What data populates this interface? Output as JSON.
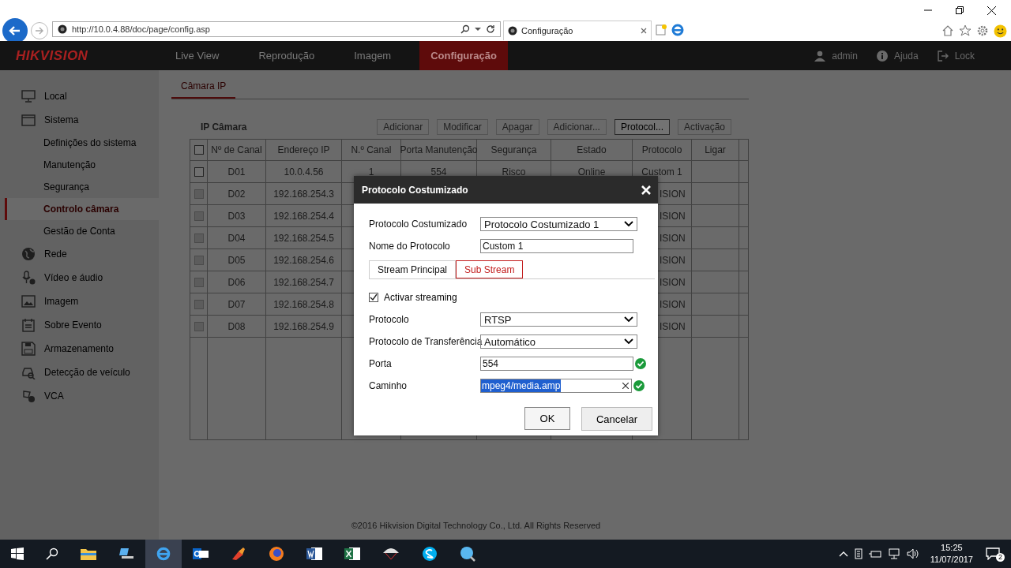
{
  "browser": {
    "address": "http://10.0.4.88/doc/page/config.asp",
    "tab_title": "Configuração"
  },
  "nav": {
    "logo": "HIKVISION",
    "items": [
      {
        "label": "Live View",
        "selected": false
      },
      {
        "label": "Reprodução",
        "selected": false
      },
      {
        "label": "Imagem",
        "selected": false
      },
      {
        "label": "Configuração",
        "selected": true
      }
    ],
    "user": "admin",
    "help": "Ajuda",
    "lock": "Lock"
  },
  "sidebar": [
    {
      "kind": "section",
      "label": "Local",
      "selected": false
    },
    {
      "kind": "section",
      "label": "Sistema",
      "selected": false
    },
    {
      "kind": "sub",
      "label": "Definições do sistema",
      "selected": false
    },
    {
      "kind": "sub",
      "label": "Manutenção",
      "selected": false
    },
    {
      "kind": "sub",
      "label": "Segurança",
      "selected": false
    },
    {
      "kind": "sub",
      "label": "Controlo câmara",
      "selected": true
    },
    {
      "kind": "sub",
      "label": "Gestão de Conta",
      "selected": false
    },
    {
      "kind": "section",
      "label": "Rede",
      "selected": false
    },
    {
      "kind": "section",
      "label": "Vídeo e áudio",
      "selected": false
    },
    {
      "kind": "section",
      "label": "Imagem",
      "selected": false
    },
    {
      "kind": "section",
      "label": "Sobre Evento",
      "selected": false
    },
    {
      "kind": "section",
      "label": "Armazenamento",
      "selected": false
    },
    {
      "kind": "section",
      "label": "Detecção de veículo",
      "selected": false
    },
    {
      "kind": "section",
      "label": "VCA",
      "selected": false
    }
  ],
  "tabs": [
    {
      "label": "Câmara IP",
      "selected": true
    }
  ],
  "table": {
    "title": "IP Câmara",
    "select_all": {
      "checked": false
    },
    "buttons": [
      {
        "label": "Adicionar",
        "disabled": true
      },
      {
        "label": "Modificar",
        "disabled": true
      },
      {
        "label": "Apagar",
        "disabled": true
      },
      {
        "label": "Adicionar...",
        "disabled": true
      },
      {
        "label": "Protocol...",
        "disabled": false
      },
      {
        "label": "Activação",
        "disabled": true
      }
    ],
    "columns": [
      "Nº de Canal",
      "Endereço IP",
      "N.º Canal",
      "Porta Manutenção",
      "Segurança",
      "Estado",
      "Protocolo",
      "Ligar"
    ],
    "rows": [
      {
        "disabled": false,
        "cells": [
          "D01",
          "10.0.4.56",
          "1",
          "554",
          "Risco",
          "Online",
          "Custom 1"
        ]
      },
      {
        "disabled": true,
        "cells": [
          "D02",
          "192.168.254.3",
          "",
          "",
          "",
          "",
          "ISION"
        ]
      },
      {
        "disabled": true,
        "cells": [
          "D03",
          "192.168.254.4",
          "",
          "",
          "",
          "",
          "ISION"
        ]
      },
      {
        "disabled": true,
        "cells": [
          "D04",
          "192.168.254.5",
          "",
          "",
          "",
          "",
          "ISION"
        ]
      },
      {
        "disabled": true,
        "cells": [
          "D05",
          "192.168.254.6",
          "",
          "",
          "",
          "",
          "ISION"
        ]
      },
      {
        "disabled": true,
        "cells": [
          "D06",
          "192.168.254.7",
          "",
          "",
          "",
          "",
          "ISION"
        ]
      },
      {
        "disabled": true,
        "cells": [
          "D07",
          "192.168.254.8",
          "",
          "",
          "",
          "",
          "ISION"
        ]
      },
      {
        "disabled": true,
        "cells": [
          "D08",
          "192.168.254.9",
          "",
          "",
          "",
          "",
          "ISION"
        ]
      }
    ]
  },
  "dialog": {
    "title": "Protocolo Costumizado",
    "custom_label": "Protocolo Costumizado",
    "custom_value": "Protocolo Costumizado 1",
    "name_label": "Nome do Protocolo",
    "name_value": "Custom 1",
    "stream_tabs": [
      {
        "label": "Stream Principal",
        "selected": false
      },
      {
        "label": "Sub Stream",
        "selected": true
      }
    ],
    "enable": {
      "label": "Activar streaming",
      "checked": true
    },
    "protocol_label": "Protocolo",
    "protocol_value": "RTSP",
    "transfer_label": "Protocolo de Transferência",
    "transfer_value": "Automático",
    "port_label": "Porta",
    "port_value": "554",
    "port_valid": true,
    "path_label": "Caminho",
    "path_value": "mpeg4/media.amp",
    "path_valid": true,
    "ok": "OK",
    "cancel": "Cancelar"
  },
  "footer": "©2016 Hikvision Digital Technology Co., Ltd. All Rights Reserved",
  "taskbar": {
    "time": "15:25",
    "date": "11/07/2017",
    "notifications": "2"
  }
}
